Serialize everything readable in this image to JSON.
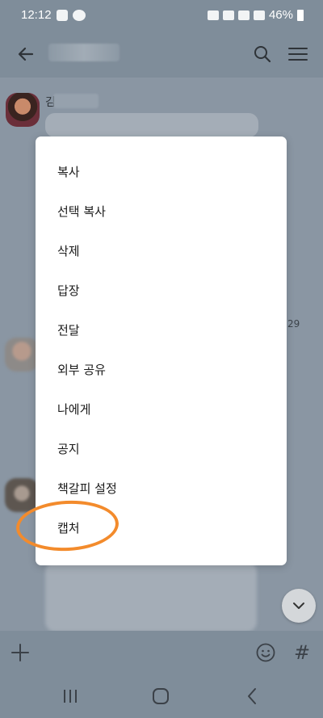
{
  "status_bar": {
    "time": "12:12",
    "battery": "46%"
  },
  "chat": {
    "sender_initial": "김",
    "time_fragment": "29"
  },
  "context_menu": {
    "items": [
      {
        "label": "복사"
      },
      {
        "label": "선택 복사"
      },
      {
        "label": "삭제"
      },
      {
        "label": "답장"
      },
      {
        "label": "전달"
      },
      {
        "label": "외부 공유"
      },
      {
        "label": "나에게"
      },
      {
        "label": "공지"
      },
      {
        "label": "책갈피 설정"
      },
      {
        "label": "캡처"
      }
    ]
  },
  "input_bar": {
    "hash_label": "#"
  },
  "colors": {
    "accent_annotation": "#f38b2c",
    "overlay_bg": "#8a96a3",
    "menu_bg": "#ffffff"
  },
  "icons": [
    "back-arrow-icon",
    "search-icon",
    "menu-icon",
    "plus-icon",
    "emoji-icon",
    "chevron-down-icon",
    "recents-icon",
    "home-icon",
    "back-nav-icon"
  ]
}
